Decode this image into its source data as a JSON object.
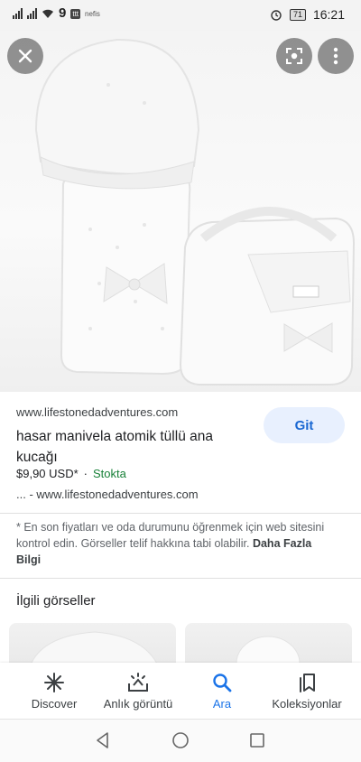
{
  "status_bar": {
    "time": "16:21",
    "battery": "71",
    "carrier_mark": "9",
    "app_badge": "ttt",
    "app_text": "nefis"
  },
  "viewer": {
    "close_icon": "close-icon",
    "lens_icon": "lens-icon",
    "more_icon": "more-vert-icon"
  },
  "product": {
    "source": "www.lifestonedadventures.com",
    "title": "hasar manivela atomik tüllü ana kucağı",
    "price": "$9,90 USD*",
    "stock": "Stokta",
    "site_line": "... - www.lifestonedadventures.com",
    "go_label": "Git"
  },
  "disclaimer": {
    "text": "* En son fiyatları ve oda durumunu öğrenmek için web sitesini kontrol edin. Görseller telif hakkına tabi olabilir.",
    "link": "Daha Fazla Bilgi"
  },
  "related": {
    "title": "İlgili görseller"
  },
  "bottom_nav": {
    "items": [
      {
        "label": "Discover",
        "icon": "asterisk-icon",
        "active": false
      },
      {
        "label": "Anlık görüntü",
        "icon": "snapshot-icon",
        "active": false
      },
      {
        "label": "Ara",
        "icon": "search-icon",
        "active": true
      },
      {
        "label": "Koleksiyonlar",
        "icon": "collections-icon",
        "active": false
      }
    ]
  },
  "colors": {
    "accent": "#1a73e8",
    "stock_green": "#188038",
    "button_bg": "#e8f0fe"
  }
}
